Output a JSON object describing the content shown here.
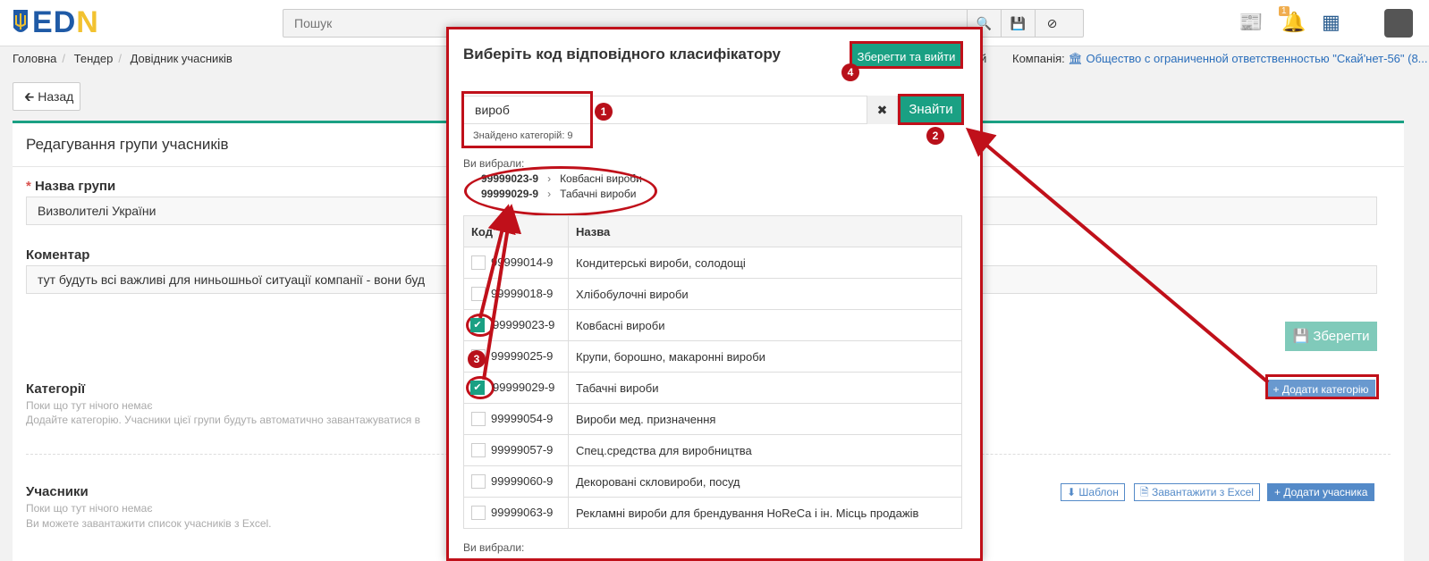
{
  "logo": {
    "text_e": "E",
    "text_d": "D",
    "text_n": "N"
  },
  "search": {
    "placeholder": "Пошук"
  },
  "notifications": {
    "badge": "1"
  },
  "breadcrumb": [
    "Головна",
    "Тендер",
    "Довідник учасників"
  ],
  "company": {
    "label": "Компанія:",
    "name": "Общество с ограниченной ответственностью \"Скай'нет-56\" (8...",
    "partial_left": "й"
  },
  "back_label": "Назад",
  "panel": {
    "title": "Редагування групи учасників",
    "group_name_label": "Назва групи",
    "group_name_value": "Визволителі України",
    "comment_label": "Коментар",
    "comment_value": "тут будуть всі важливі для ниньошньої ситуації компанії - вони буд",
    "save_label": "Зберегти",
    "categories_label": "Категорії",
    "categories_empty": "Поки що тут нічого немає",
    "categories_hint": "Додайте категорію. Учасники цієї групи будуть автоматично завантажуватися в",
    "add_category_label": "Додати категорію",
    "participants_label": "Учасники",
    "participants_empty": "Поки що тут нічого немає",
    "participants_hint": "Ви можете завантажити список учасників з Excel.",
    "template_label": "Шаблон",
    "upload_excel_label": "Завантажити з Excel",
    "add_participant_label": "Додати учасника"
  },
  "modal": {
    "title": "Виберіть код відповідного класифікатору",
    "save_exit_label": "Зберегти та вийти",
    "search_value": "вироб",
    "find_label": "Знайти",
    "found_text": "Знайдено категорій: 9",
    "chosen_label": "Ви вибрали:",
    "chosen": [
      {
        "code": "99999023-9",
        "name": "Ковбасні вироби"
      },
      {
        "code": "99999029-9",
        "name": "Табачні вироби"
      }
    ],
    "col_code": "Код",
    "col_name": "Назва",
    "rows": [
      {
        "code": "99999014-9",
        "name": "Кондитерські вироби, солодощі",
        "checked": false
      },
      {
        "code": "99999018-9",
        "name": "Хлібобулочні вироби",
        "checked": false
      },
      {
        "code": "99999023-9",
        "name": "Ковбасні вироби",
        "checked": true
      },
      {
        "code": "99999025-9",
        "name": "Крупи, борошно, макаронні вироби",
        "checked": false
      },
      {
        "code": "99999029-9",
        "name": "Табачні вироби",
        "checked": true
      },
      {
        "code": "99999054-9",
        "name": "Вироби мед. призначення",
        "checked": false
      },
      {
        "code": "99999057-9",
        "name": "Спец.средства для виробництва",
        "checked": false
      },
      {
        "code": "99999060-9",
        "name": "Декоровані скловироби, посуд",
        "checked": false
      },
      {
        "code": "99999063-9",
        "name": "Рекламні вироби для брендування HoReCa і ін. Місць продажів",
        "checked": false
      }
    ],
    "bottom_chosen_label": "Ви вибрали:"
  },
  "annotations": {
    "n1": "1",
    "n2": "2",
    "n3": "3",
    "n4": "4"
  },
  "colors": {
    "accent": "#1aa083",
    "annotation": "#c0101a",
    "link": "#2a6ebb"
  }
}
